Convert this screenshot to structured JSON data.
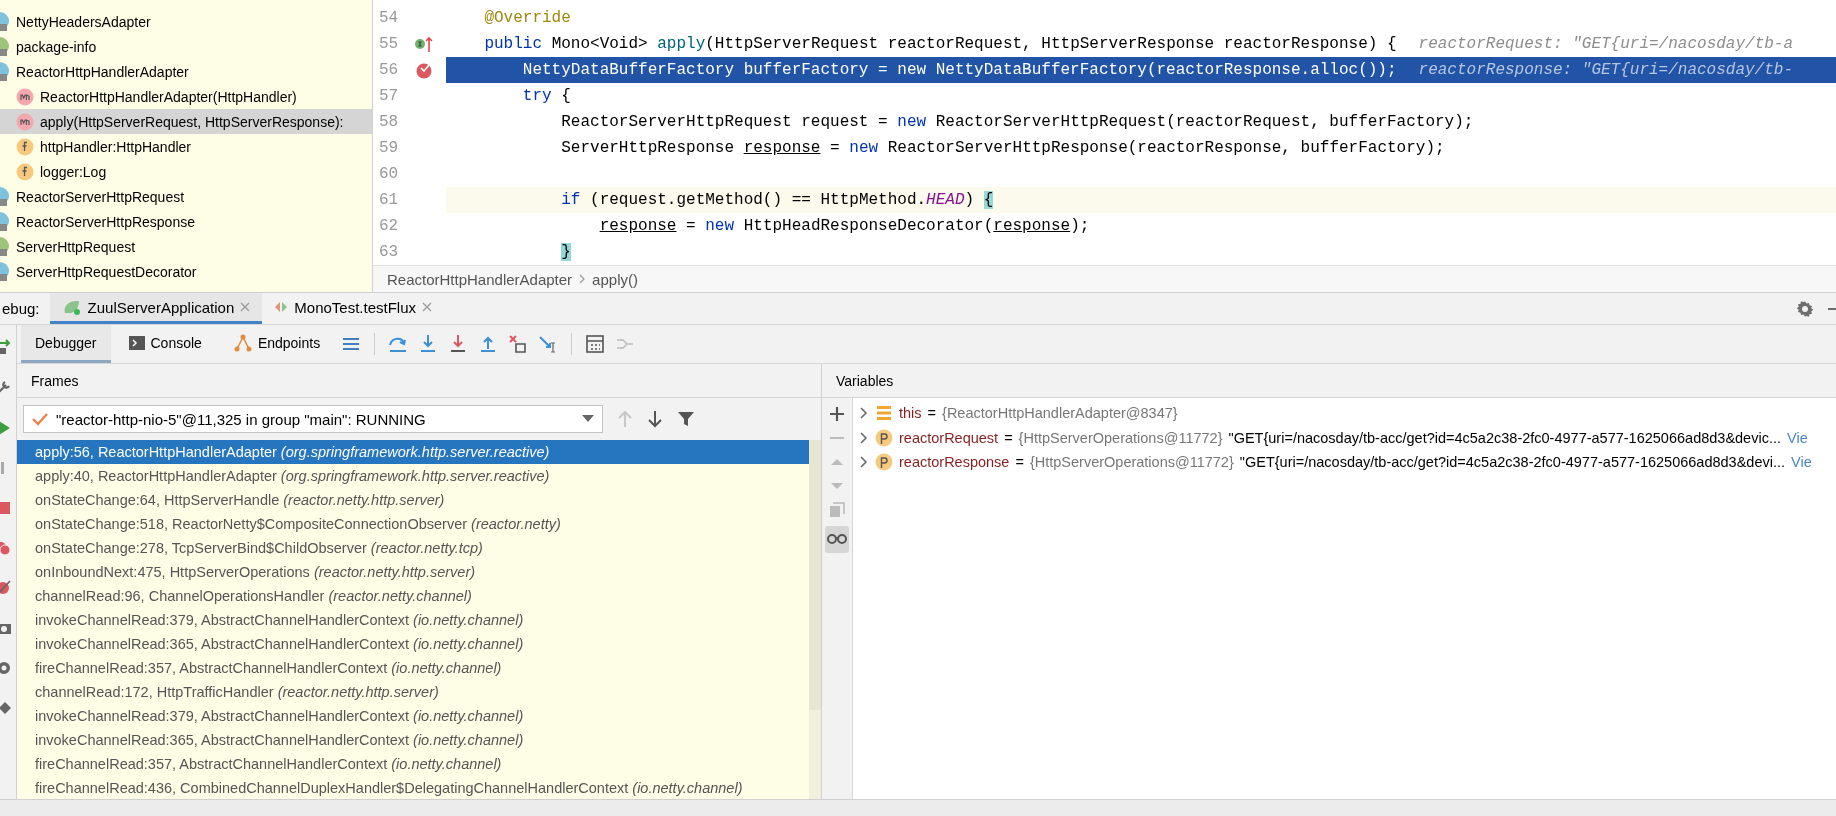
{
  "structure": {
    "items": [
      {
        "label": "NettyHeadersAdapter",
        "kind": "class",
        "selected": false
      },
      {
        "label": "package-info",
        "kind": "interface",
        "selected": false
      },
      {
        "label": "ReactorHttpHandlerAdapter",
        "kind": "class",
        "selected": false,
        "children": [
          {
            "label": "ReactorHttpHandlerAdapter(HttpHandler)",
            "kind": "method",
            "selected": false
          },
          {
            "label": "apply(HttpServerRequest, HttpServerResponse):",
            "kind": "method",
            "selected": true
          },
          {
            "label": "httpHandler:HttpHandler",
            "kind": "field",
            "selected": false
          },
          {
            "label": "logger:Log",
            "kind": "field",
            "selected": false
          }
        ]
      },
      {
        "label": "ReactorServerHttpRequest",
        "kind": "class",
        "selected": false
      },
      {
        "label": "ReactorServerHttpResponse",
        "kind": "class",
        "selected": false
      },
      {
        "label": "ServerHttpRequest",
        "kind": "interface",
        "selected": false
      },
      {
        "label": "ServerHttpRequestDecorator",
        "kind": "class",
        "selected": false
      }
    ]
  },
  "editor": {
    "lines": [
      {
        "number": "54",
        "kind": "plain",
        "current": false,
        "caret": false,
        "tokens": [
          {
            "text": "    @Override",
            "kind": "annotation"
          }
        ]
      },
      {
        "number": "55",
        "kind": "override",
        "current": false,
        "caret": false,
        "tokens": [
          {
            "text": "    public",
            "kind": "keyword"
          },
          {
            "text": " Mono<Void> ",
            "kind": "plain"
          },
          {
            "text": "apply",
            "kind": "method"
          },
          {
            "text": "(HttpServerRequest reactorRequest, HttpServerResponse reactorResponse) {",
            "kind": "plain"
          }
        ],
        "hint": "reactorRequest: \"GET{uri=/nacosday/tb-a"
      },
      {
        "number": "56",
        "kind": "breakpoint",
        "current": true,
        "caret": false,
        "tokens": [
          {
            "text": "        NettyDataBufferFactory bufferFactory = new NettyDataBufferFactory(reactorResponse.alloc());",
            "kind": "plain"
          }
        ],
        "hint": "reactorResponse: \"GET{uri=/nacosday/tb-"
      },
      {
        "number": "57",
        "kind": "plain",
        "current": false,
        "caret": false,
        "tokens": [
          {
            "text": "        try",
            "kind": "keyword"
          },
          {
            "text": " {",
            "kind": "plain"
          }
        ]
      },
      {
        "number": "58",
        "kind": "plain",
        "current": false,
        "caret": false,
        "tokens": [
          {
            "text": "            ReactorServerHttpRequest request = ",
            "kind": "plain"
          },
          {
            "text": "new",
            "kind": "keyword"
          },
          {
            "text": " ReactorServerHttpRequest(reactorRequest, bufferFactory);",
            "kind": "plain"
          }
        ]
      },
      {
        "number": "59",
        "kind": "plain",
        "current": false,
        "caret": false,
        "tokens": [
          {
            "text": "            ServerHttpResponse ",
            "kind": "plain"
          },
          {
            "text": "response",
            "kind": "reassigned"
          },
          {
            "text": " = ",
            "kind": "plain"
          },
          {
            "text": "new",
            "kind": "keyword"
          },
          {
            "text": " ReactorServerHttpResponse(reactorResponse, bufferFactory);",
            "kind": "plain"
          }
        ]
      },
      {
        "number": "60",
        "kind": "plain",
        "current": false,
        "caret": false
      },
      {
        "number": "61",
        "kind": "plain",
        "current": false,
        "caret": true,
        "tokens": [
          {
            "text": "            if",
            "kind": "keyword"
          },
          {
            "text": " (request.getMethod() == HttpMethod.",
            "kind": "plain"
          },
          {
            "text": "HEAD",
            "kind": "constant"
          },
          {
            "text": ") ",
            "kind": "plain"
          },
          {
            "text": "{",
            "kind": "brace"
          }
        ]
      },
      {
        "number": "62",
        "kind": "plain",
        "current": false,
        "caret": false,
        "tokens": [
          {
            "text": "                response",
            "kind": "reassigned"
          },
          {
            "text": " = ",
            "kind": "plain"
          },
          {
            "text": "new",
            "kind": "keyword"
          },
          {
            "text": " HttpHeadResponseDecorator(",
            "kind": "plain"
          },
          {
            "text": "response",
            "kind": "reassigned"
          },
          {
            "text": ");",
            "kind": "plain"
          }
        ]
      },
      {
        "number": "63",
        "kind": "plain",
        "current": false,
        "caret": false,
        "tokens": [
          {
            "text": "            }",
            "kind": "brace"
          }
        ]
      }
    ],
    "breadcrumbs": [
      "ReactorHttpHandlerAdapter",
      "apply()"
    ]
  },
  "debug": {
    "label": "ebug:",
    "tabs": [
      {
        "label": "ZuulServerApplication",
        "kind": "app",
        "selected": true
      },
      {
        "label": "MonoTest.testFlux",
        "kind": "test",
        "selected": false
      }
    ],
    "subtabs": [
      {
        "label": "Debugger",
        "kind": "plain",
        "selected": true
      },
      {
        "label": "Console",
        "kind": "console",
        "selected": false
      },
      {
        "label": "Endpoints",
        "kind": "endpoints",
        "selected": false
      }
    ]
  },
  "frames": {
    "title": "Frames",
    "thread": "\"reactor-http-nio-5\"@11,325 in group \"main\": RUNNING",
    "items": [
      {
        "text": "apply:56, ReactorHttpHandlerAdapter *(org.springframework.http.server.reactive)*",
        "selected": true
      },
      {
        "text": "apply:40, ReactorHttpHandlerAdapter *(org.springframework.http.server.reactive)*",
        "selected": false
      },
      {
        "text": "onStateChange:64, HttpServerHandle *(reactor.netty.http.server)*",
        "selected": false
      },
      {
        "text": "onStateChange:518, ReactorNetty$CompositeConnectionObserver *(reactor.netty)*",
        "selected": false
      },
      {
        "text": "onStateChange:278, TcpServerBind$ChildObserver *(reactor.netty.tcp)*",
        "selected": false
      },
      {
        "text": "onInboundNext:475, HttpServerOperations *(reactor.netty.http.server)*",
        "selected": false
      },
      {
        "text": "channelRead:96, ChannelOperationsHandler *(reactor.netty.channel)*",
        "selected": false
      },
      {
        "text": "invokeChannelRead:379, AbstractChannelHandlerContext *(io.netty.channel)*",
        "selected": false
      },
      {
        "text": "invokeChannelRead:365, AbstractChannelHandlerContext *(io.netty.channel)*",
        "selected": false
      },
      {
        "text": "fireChannelRead:357, AbstractChannelHandlerContext *(io.netty.channel)*",
        "selected": false
      },
      {
        "text": "channelRead:172, HttpTrafficHandler *(reactor.netty.http.server)*",
        "selected": false
      },
      {
        "text": "invokeChannelRead:379, AbstractChannelHandlerContext *(io.netty.channel)*",
        "selected": false
      },
      {
        "text": "invokeChannelRead:365, AbstractChannelHandlerContext *(io.netty.channel)*",
        "selected": false
      },
      {
        "text": "fireChannelRead:357, AbstractChannelHandlerContext *(io.netty.channel)*",
        "selected": false
      },
      {
        "text": "fireChannelRead:436, CombinedChannelDuplexHandler$DelegatingChannelHandlerContext *(io.netty.channel)*",
        "selected": false
      }
    ]
  },
  "variables": {
    "title": "Variables",
    "items": [
      {
        "kind": "object",
        "name": "this",
        "separator": "=",
        "value": "{ReactorHttpHandlerAdapter@8347}"
      },
      {
        "kind": "parameter",
        "name": "reactorRequest",
        "separator": "=",
        "value": "{HttpServerOperations@11772}",
        "string": "\"GET{uri=/nacosday/tb-acc/get?id=4c5a2c38-2fc0-4977-a577-1625066ad8d3&devic...",
        "link": "Vie"
      },
      {
        "kind": "parameter",
        "name": "reactorResponse",
        "separator": "=",
        "value": "{HttpServerOperations@11772}",
        "string": "\"GET{uri=/nacosday/tb-acc/get?id=4c5a2c38-2fc0-4977-a577-1625066ad8d3&devi...",
        "link": "Vie"
      }
    ]
  }
}
